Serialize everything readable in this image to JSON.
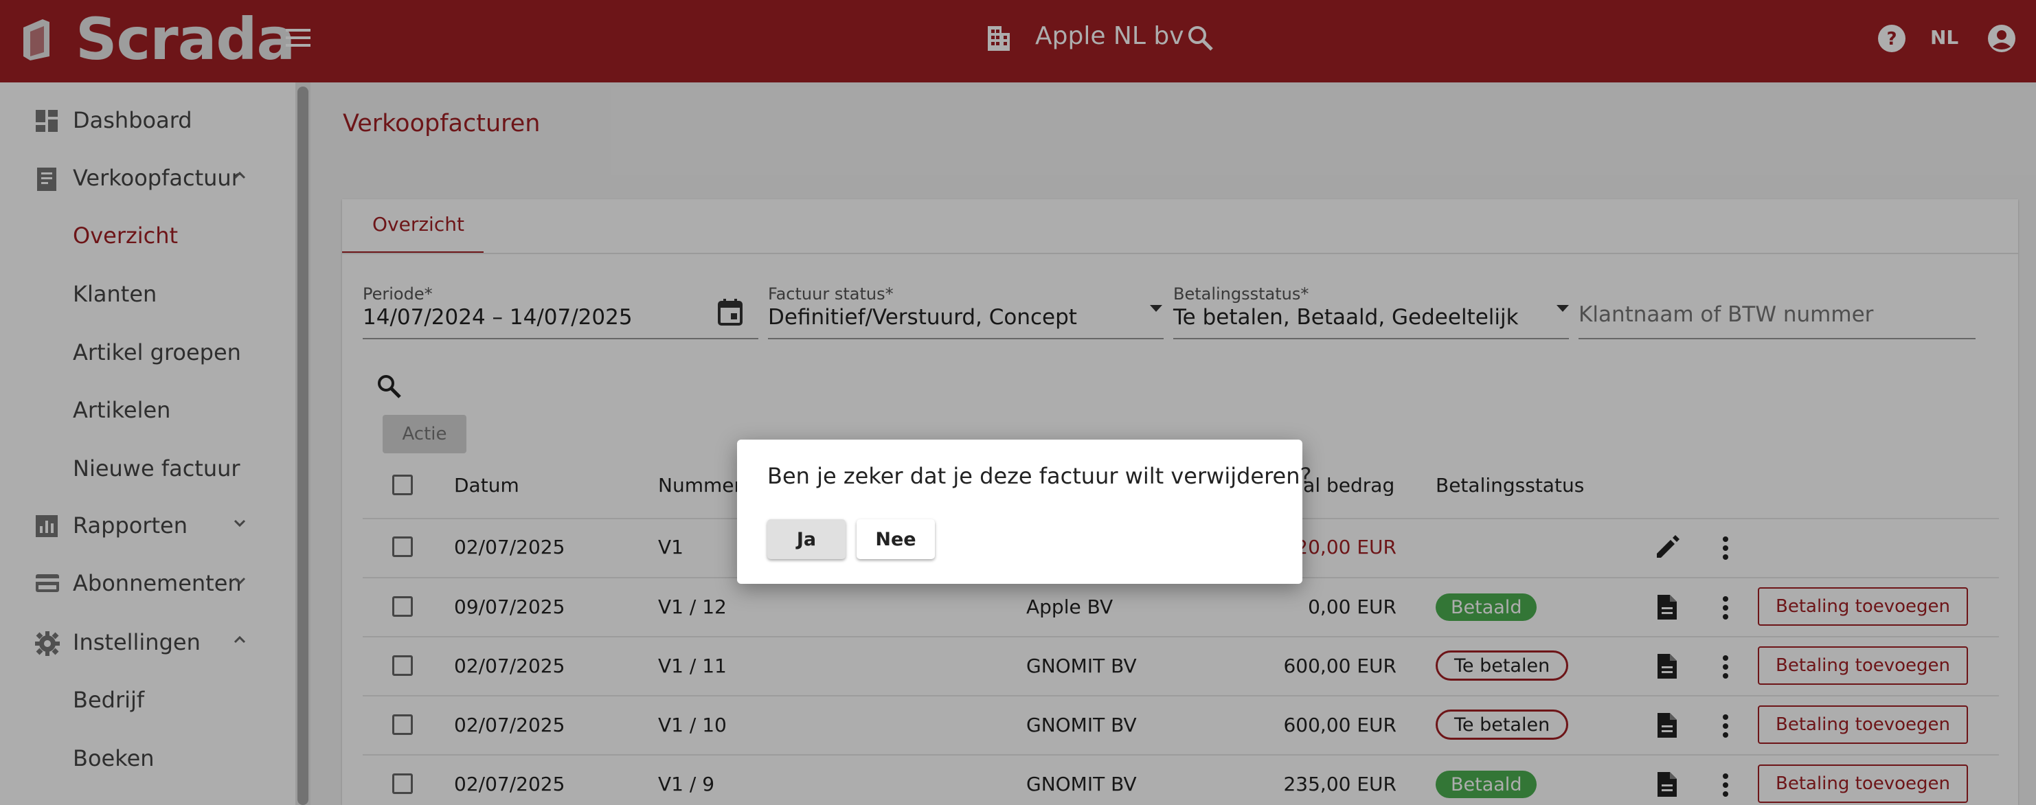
{
  "header": {
    "logo_text": "Scrada",
    "company_name": "Apple NL bv",
    "language": "NL"
  },
  "sidebar": {
    "items": [
      {
        "label": "Dashboard",
        "icon": "dashboard-icon"
      },
      {
        "label": "Verkoopfactuur",
        "icon": "receipt-icon"
      },
      {
        "label": "Overzicht"
      },
      {
        "label": "Klanten"
      },
      {
        "label": "Artikel groepen"
      },
      {
        "label": "Artikelen"
      },
      {
        "label": "Nieuwe factuur"
      },
      {
        "label": "Rapporten",
        "icon": "bar-chart-icon"
      },
      {
        "label": "Abonnementen",
        "icon": "credit-card-icon"
      },
      {
        "label": "Instellingen",
        "icon": "gear-icon"
      },
      {
        "label": "Bedrijf"
      },
      {
        "label": "Boeken"
      }
    ]
  },
  "main": {
    "title": "Verkoopfacturen",
    "tab": "Overzicht",
    "filters": {
      "periode_label": "Periode*",
      "periode_value": "14/07/2024 – 14/07/2025",
      "factuur_status_label": "Factuur status*",
      "factuur_status_value": "Definitief/Verstuurd, Concept",
      "betalingsstatus_label": "Betalingsstatus*",
      "betalingsstatus_value": "Te betalen, Betaald, Gedeeltelijk",
      "klant_placeholder": "Klantnaam of BTW nummer"
    },
    "actie_label": "Actie",
    "columns": [
      "Datum",
      "Nummer",
      "aal bedrag",
      "Betalingsstatus"
    ],
    "rows": [
      {
        "datum": "02/07/2025",
        "nummer": "V1",
        "klant": "",
        "bedrag": "120,00 EUR",
        "status": "",
        "pay": ""
      },
      {
        "datum": "09/07/2025",
        "nummer": "V1 / 12",
        "klant": "Apple BV",
        "bedrag": "0,00 EUR",
        "status": "Betaald",
        "pay": "Betaling toevoegen"
      },
      {
        "datum": "02/07/2025",
        "nummer": "V1 / 11",
        "klant": "GNOMIT BV",
        "bedrag": "600,00 EUR",
        "status": "Te betalen",
        "pay": "Betaling toevoegen"
      },
      {
        "datum": "02/07/2025",
        "nummer": "V1 / 10",
        "klant": "GNOMIT BV",
        "bedrag": "600,00 EUR",
        "status": "Te betalen",
        "pay": "Betaling toevoegen"
      },
      {
        "datum": "02/07/2025",
        "nummer": "V1 / 9",
        "klant": "GNOMIT BV",
        "bedrag": "235,00 EUR",
        "status": "Betaald",
        "pay": "Betaling toevoegen"
      }
    ]
  },
  "dialog": {
    "message": "Ben je zeker dat je deze factuur wilt verwijderen?",
    "yes_label": "Ja",
    "no_label": "Nee"
  },
  "colors": {
    "brand": "#a11f24",
    "paid": "#4caf50"
  }
}
